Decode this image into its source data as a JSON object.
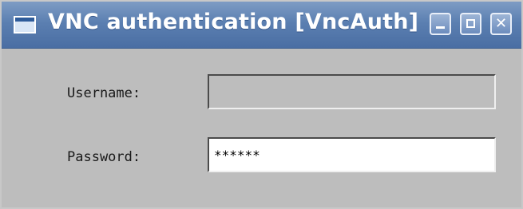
{
  "window": {
    "title": "VNC authentication [VncAuth]",
    "buttons": {
      "minimize_icon": "minimize-icon",
      "maximize_icon": "maximize-icon",
      "close_icon": "close-icon",
      "close_glyph": "✕"
    }
  },
  "form": {
    "username": {
      "label": "Username:",
      "value": ""
    },
    "password": {
      "label": "Password:",
      "value": "******"
    }
  },
  "colors": {
    "titlebar": "#5b7fb1",
    "window_bg": "#bdbdbd",
    "active_field_bg": "#ffffff"
  }
}
